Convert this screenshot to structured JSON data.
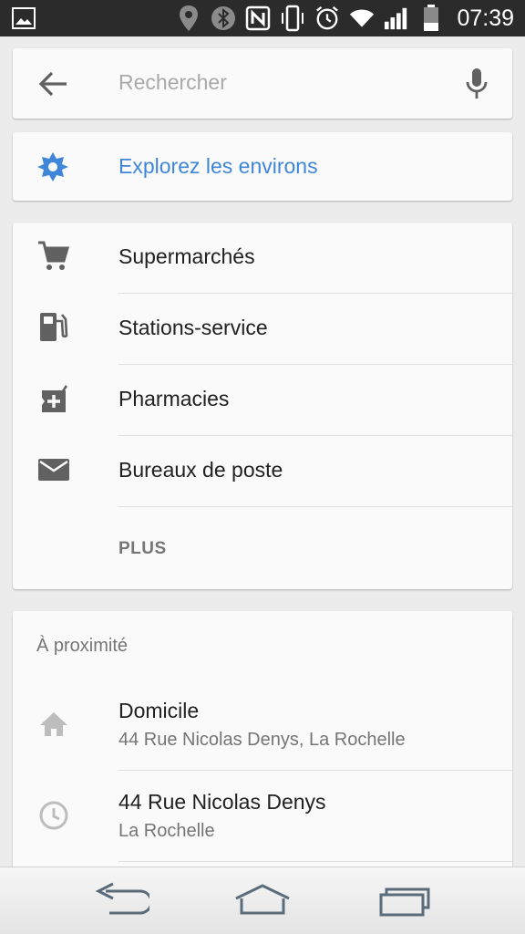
{
  "status_bar": {
    "time": "07:39",
    "icons": [
      "image-icon",
      "location-pin-icon",
      "bluetooth-icon",
      "nfc-icon",
      "vibrate-icon",
      "alarm-icon",
      "wifi-icon",
      "signal-icon",
      "battery-icon"
    ]
  },
  "search": {
    "placeholder": "Rechercher",
    "icons": [
      "back-arrow-icon",
      "microphone-icon"
    ]
  },
  "explore": {
    "label": "Explorez les environs",
    "accent_color": "#3f86d9",
    "icon": "explore-compass-icon"
  },
  "categories": {
    "items": [
      {
        "label": "Supermarchés",
        "icon": "shopping-cart-icon"
      },
      {
        "label": "Stations-service",
        "icon": "gas-station-icon"
      },
      {
        "label": "Pharmacies",
        "icon": "pharmacy-icon"
      },
      {
        "label": "Bureaux de poste",
        "icon": "mail-icon"
      }
    ],
    "more_label": "PLUS"
  },
  "nearby": {
    "heading": "À proximité",
    "items": [
      {
        "title": "Domicile",
        "subtitle": "44 Rue Nicolas Denys, La Rochelle",
        "icon": "home-icon"
      },
      {
        "title": "44 Rue Nicolas Denys",
        "subtitle": "La Rochelle",
        "icon": "history-clock-icon"
      }
    ]
  },
  "nav_bar": {
    "icons": [
      "nav-back-icon",
      "nav-home-icon",
      "nav-recents-icon"
    ]
  }
}
